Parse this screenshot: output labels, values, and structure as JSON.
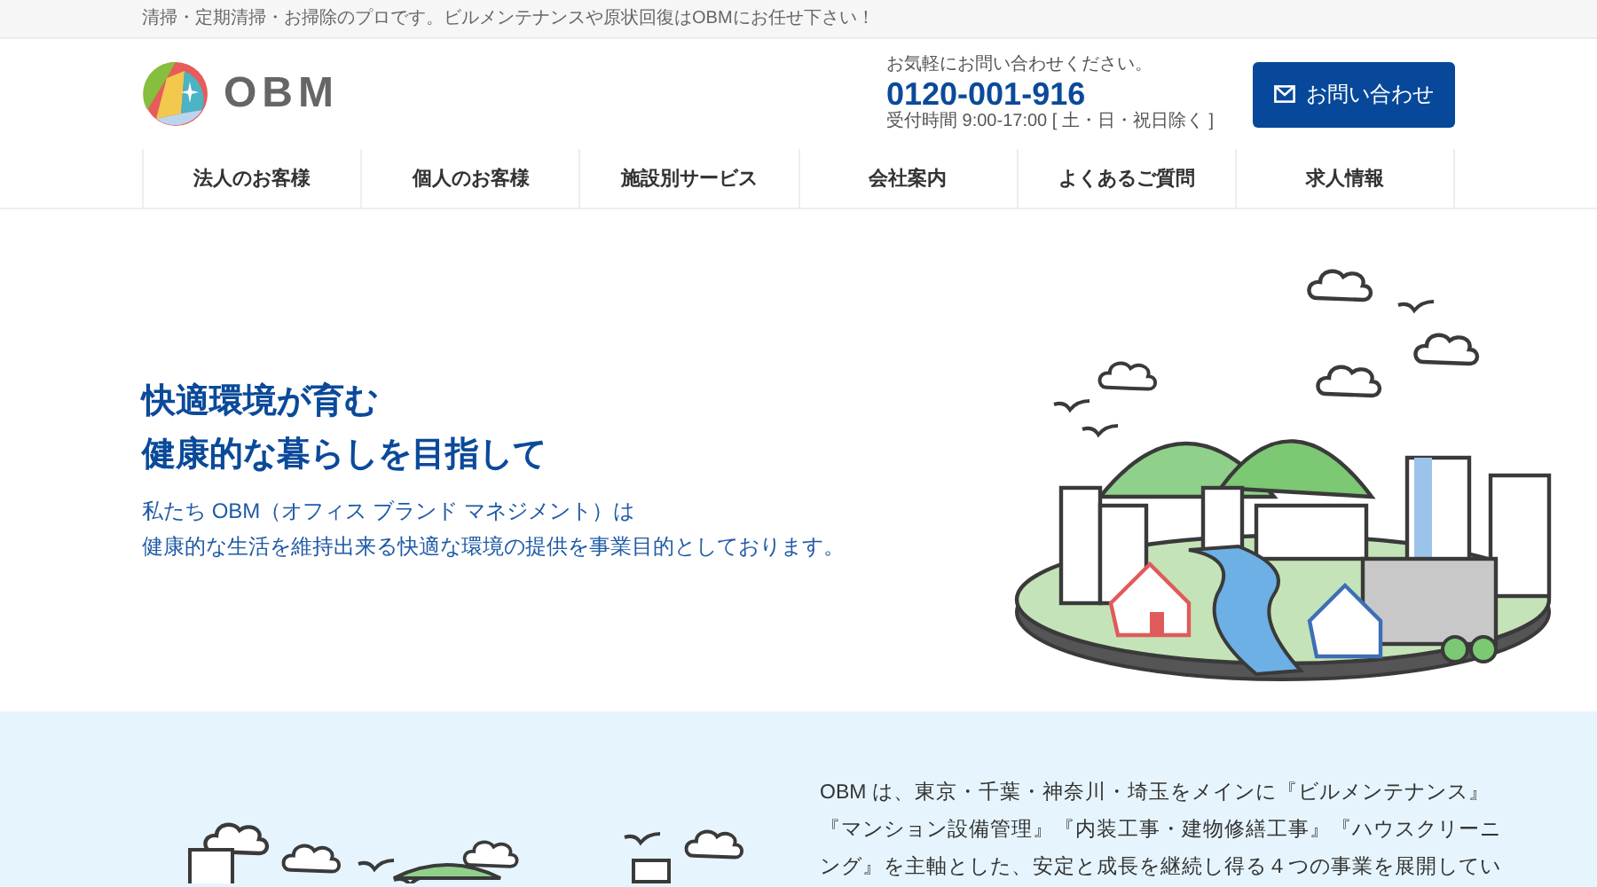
{
  "top_bar": {
    "text": "清掃・定期清掃・お掃除のプロです。ビルメンテナンスや原状回復はOBMにお任せ下さい！"
  },
  "header": {
    "logo_text": "OBM",
    "contact": {
      "note": "お気軽にお問い合わせください。",
      "phone": "0120-001-916",
      "hours": "受付時間 9:00-17:00 [ 土・日・祝日除く ]"
    },
    "button": "お問い合わせ"
  },
  "nav": {
    "items": [
      {
        "label": "法人のお客様"
      },
      {
        "label": "個人のお客様"
      },
      {
        "label": "施設別サービス"
      },
      {
        "label": "会社案内"
      },
      {
        "label": "よくあるご質問"
      },
      {
        "label": "求人情報"
      }
    ]
  },
  "hero": {
    "heading_lines": [
      "快適環境が育む",
      "健康的な暮らしを目指して"
    ],
    "body_lines": [
      "私たち OBM（オフィス ブランド マネジメント）は",
      "健康的な生活を維持出来る快適な環境の提供を事業目的としております。"
    ]
  },
  "about": {
    "lines": [
      "OBM は、東京・千葉・神奈川・埼玉をメインに『ビルメンテナンス』",
      "『マンション設備管理』『内装工事・建物修繕工事』『ハウスクリーニ",
      "ング』を主軸とした、安定と成長を継続し得る４つの事業を展開してい"
    ]
  }
}
